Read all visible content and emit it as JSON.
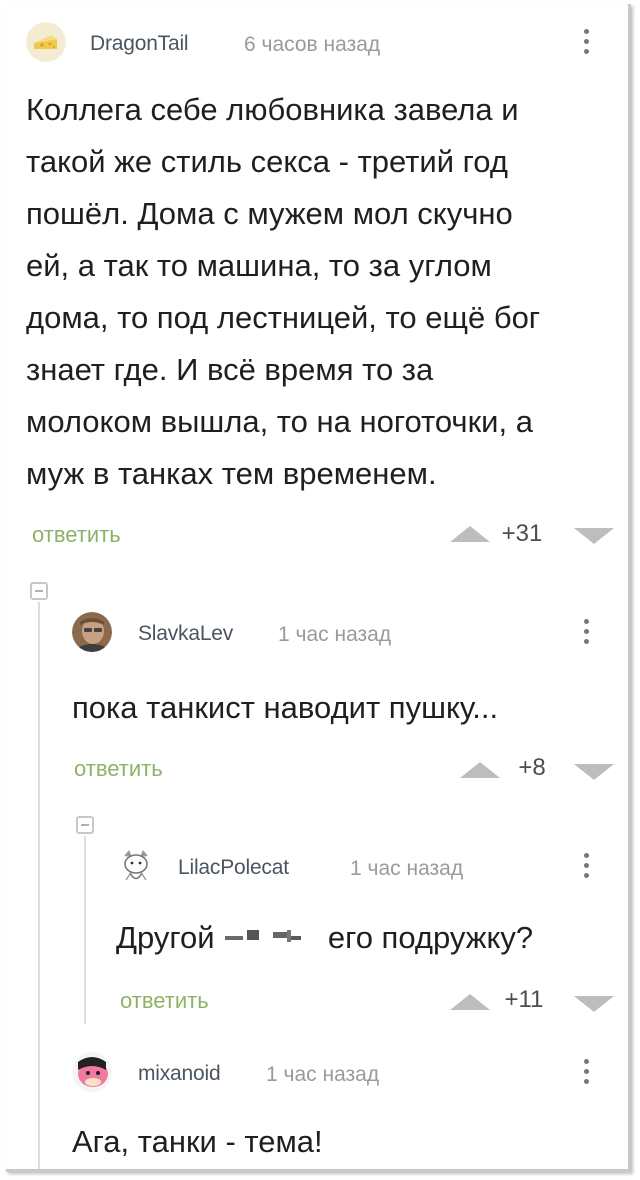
{
  "comments": [
    {
      "username": "DragonTail",
      "time": "6 часов назад",
      "text_lines": [
        "Коллега себе любовника завела и",
        "такой же стиль секса - третий год",
        "пошёл. Дома с мужем мол скучно",
        "ей, а так то машина, то за углом",
        "дома, то под лестницей, то ещё бог",
        "знает где. И всё время то за",
        "молоком вышла, то на ноготочки, а",
        "муж в танках тем временем."
      ],
      "reply_label": "ответить",
      "rating": "+31"
    },
    {
      "username": "SlavkaLev",
      "time": "1 час назад",
      "text_lines": [
        "пока танкист наводит пушку..."
      ],
      "reply_label": "ответить",
      "rating": "+8"
    },
    {
      "username": "LilacPolecat",
      "time": "1 час назад",
      "text_before": "Другой",
      "text_after": "его подружку?",
      "reply_label": "ответить",
      "rating": "+11"
    },
    {
      "username": "mixanoid",
      "time": "1 час назад",
      "text_lines": [
        "Ага, танки - тема!"
      ]
    }
  ],
  "colors": {
    "reply": "#8fb269",
    "username": "#4a5560",
    "time": "#9a9a9a",
    "vote_arrow": "#bdbdbd"
  }
}
